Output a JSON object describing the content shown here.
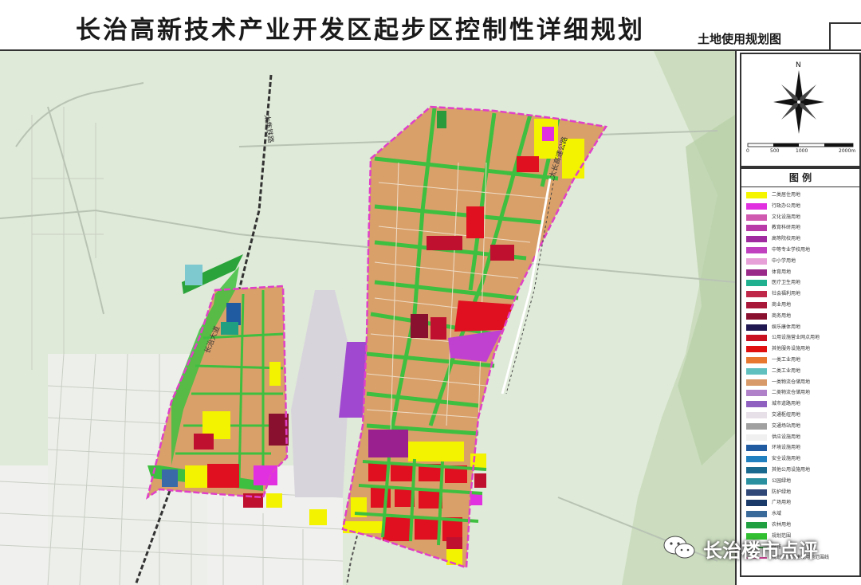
{
  "header": {
    "title": "长治高新技术产业开发区起步区控制性详细规划",
    "subtitle": "土地使用规划图"
  },
  "compass": {
    "north_label": "N",
    "scale_labels": [
      "0",
      "500",
      "1000",
      "2000m"
    ]
  },
  "legend": {
    "title": "图 例",
    "items": [
      {
        "label": "二类居住用地",
        "color": "#f5f500"
      },
      {
        "label": "行政办公用地",
        "color": "#e030e0"
      },
      {
        "label": "文化设施用地",
        "color": "#d05ab0"
      },
      {
        "label": "教育科研用地",
        "color": "#b83aa8"
      },
      {
        "label": "高等院校用地",
        "color": "#a02aa0"
      },
      {
        "label": "中等专业学校用地",
        "color": "#c040c0"
      },
      {
        "label": "中小学用地",
        "color": "#e8a0d8"
      },
      {
        "label": "体育用地",
        "color": "#9a2a8a"
      },
      {
        "label": "医疗卫生用地",
        "color": "#20b090"
      },
      {
        "label": "社会福利用地",
        "color": "#c0284a"
      },
      {
        "label": "商业用地",
        "color": "#a81838"
      },
      {
        "label": "商务用地",
        "color": "#8a1030"
      },
      {
        "label": "娱乐康体用地",
        "color": "#201850"
      },
      {
        "label": "公用设施营业网点用地",
        "color": "#c81020"
      },
      {
        "label": "其他服务设施用地",
        "color": "#e01010"
      },
      {
        "label": "一类工业用地",
        "color": "#e87830"
      },
      {
        "label": "二类工业用地",
        "color": "#60c0c0"
      },
      {
        "label": "一类物流仓储用地",
        "color": "#d89a68"
      },
      {
        "label": "二类物流仓储用地",
        "color": "#b080c8"
      },
      {
        "label": "城市道路用地",
        "color": "#9060c0"
      },
      {
        "label": "交通枢纽用地",
        "color": "#e8e0e8"
      },
      {
        "label": "交通场站用地",
        "color": "#a0a0a0"
      },
      {
        "label": "供应设施用地",
        "color": "#f0f0f0"
      },
      {
        "label": "环境设施用地",
        "color": "#205aa0"
      },
      {
        "label": "安全设施用地",
        "color": "#2080c0"
      },
      {
        "label": "其他公用设施用地",
        "color": "#1a6a90"
      },
      {
        "label": "公园绿地",
        "color": "#2a90a0"
      },
      {
        "label": "防护绿地",
        "color": "#304878"
      },
      {
        "label": "广场用地",
        "color": "#1a3a6a"
      },
      {
        "label": "水域",
        "color": "#3a6a9a"
      },
      {
        "label": "农林用地",
        "color": "#20a040"
      },
      {
        "label": "规划范围",
        "color": "#30c030"
      },
      {
        "label": "铁路",
        "color": "#109020"
      },
      {
        "label": "规划区规划建设用地范围线",
        "color": "#e040a0"
      }
    ]
  },
  "map": {
    "labels": {
      "railway": "太焦铁路",
      "road_east": "太长高速公路",
      "road_west": "长治大道"
    },
    "colors": {
      "background": "#dfead8",
      "industrial": "#d9a06a",
      "green_belt": "#3fbf3f",
      "residential": "#f3f300",
      "commercial": "#d8202e",
      "boundary": "#e040c8",
      "airport": "#d8d4dc",
      "urban": "#f2f2f2"
    }
  },
  "watermark": {
    "text": "长治楼市点评",
    "icon": "wechat-icon"
  }
}
